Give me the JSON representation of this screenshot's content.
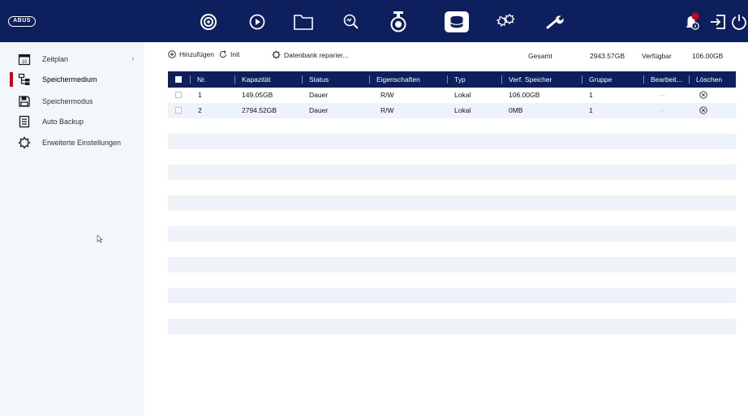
{
  "app": {
    "logo_text": "ABUS"
  },
  "topbar": {
    "nav": [
      {
        "name": "live-view-icon",
        "active": false
      },
      {
        "name": "playback-icon",
        "active": false
      },
      {
        "name": "file-management-icon",
        "active": false
      },
      {
        "name": "smart-search-icon",
        "active": false
      },
      {
        "name": "camera-icon",
        "active": false
      },
      {
        "name": "storage-icon",
        "active": true
      },
      {
        "name": "system-settings-icon",
        "active": false
      },
      {
        "name": "maintenance-icon",
        "active": false
      }
    ],
    "alarm_icon": "alarm-icon",
    "alarm_badge_color": "#d0021b",
    "logout_icon": "logout-icon",
    "power_icon": "power-icon"
  },
  "sidebar": {
    "items": [
      {
        "label": "Zeitplan",
        "icon": "calendar-icon",
        "has_submenu": true,
        "chevron": "›"
      },
      {
        "label": "Speichermedium",
        "icon": "hdd-tree-icon",
        "active": true
      },
      {
        "label": "Speichermodus",
        "icon": "floppy-disk-icon"
      },
      {
        "label": "Auto Backup",
        "icon": "backup-document-icon"
      },
      {
        "label": "Erweiterte Einstellungen",
        "icon": "gear-icon"
      }
    ]
  },
  "toolbar": {
    "add_label": "Hinzufügen",
    "init_label": "Init",
    "repair_label": "Datenbank reparier...",
    "total_label": "Gesamt",
    "total_value": "2943.57GB",
    "available_label": "Verfügbar",
    "available_value": "106.00GB"
  },
  "table": {
    "headers": {
      "nr": "Nr.",
      "capacity": "Kapazität",
      "status": "Status",
      "properties": "Eigenschaften",
      "type": "Typ",
      "free_space": "Verf. Speicher",
      "group": "Gruppe",
      "edit": "Bearbeit...",
      "delete": "Löschen"
    },
    "rows": [
      {
        "nr": "1",
        "capacity": "149.05GB",
        "status": "Dauer",
        "properties": "R/W",
        "type": "Lokal",
        "free_space": "106.00GB",
        "group": "1",
        "edit": "—"
      },
      {
        "nr": "2",
        "capacity": "2794.52GB",
        "status": "Dauer",
        "properties": "R/W",
        "type": "Lokal",
        "free_space": "0MB",
        "group": "1",
        "edit": "—"
      }
    ]
  },
  "colors": {
    "topbar": "#0d1f5c",
    "header": "#0d1f5c",
    "accent": "#d0021b",
    "stripe": "#eef3f9"
  }
}
